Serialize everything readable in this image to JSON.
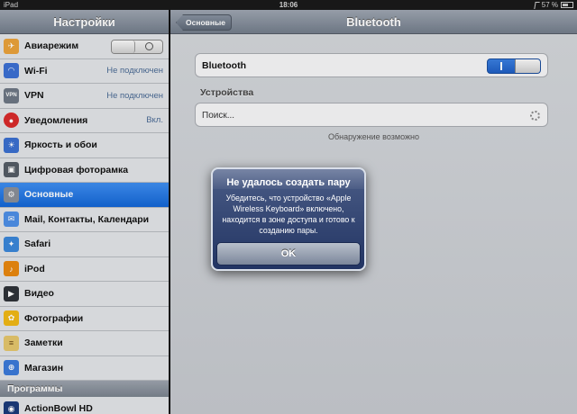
{
  "status_bar": {
    "device": "iPad",
    "time": "18:06",
    "battery": "57 %"
  },
  "sidebar": {
    "title": "Настройки",
    "items": [
      {
        "label": "Авиарежим",
        "icon": "airplane-icon",
        "color": "#e9a23b"
      },
      {
        "label": "Wi-Fi",
        "value": "Не подключен",
        "icon": "wifi-icon",
        "color": "#3b6fd2"
      },
      {
        "label": "VPN",
        "value": "Не подключен",
        "icon": "vpn-icon",
        "color": "#6d7784"
      },
      {
        "label": "Уведомления",
        "value": "Вкл.",
        "icon": "notifications-icon",
        "color": "#d92b2b"
      },
      {
        "label": "Яркость и обои",
        "icon": "brightness-icon",
        "color": "#3a6fcf"
      },
      {
        "label": "Цифровая фоторамка",
        "icon": "picture-frame-icon",
        "color": "#555c66"
      },
      {
        "label": "Основные",
        "icon": "gear-icon",
        "color": "#8a8f98"
      },
      {
        "label": "Mail, Контакты, Календари",
        "icon": "mail-icon",
        "color": "#4d8fe6"
      },
      {
        "label": "Safari",
        "icon": "safari-icon",
        "color": "#3a86d9"
      },
      {
        "label": "iPod",
        "icon": "ipod-icon",
        "color": "#e8870f"
      },
      {
        "label": "Видео",
        "icon": "video-icon",
        "color": "#2e3238"
      },
      {
        "label": "Фотографии",
        "icon": "photos-icon",
        "color": "#f0b816"
      },
      {
        "label": "Заметки",
        "icon": "notes-icon",
        "color": "#e4c66c"
      },
      {
        "label": "Магазин",
        "icon": "store-icon",
        "color": "#3b7ad9"
      }
    ],
    "section_programs": "Программы",
    "app_item": {
      "label": "ActionBowl HD",
      "icon": "actionbowl-icon",
      "color": "#1b3a7a"
    }
  },
  "detail": {
    "back_label": "Основные",
    "title": "Bluetooth",
    "bluetooth_label": "Bluetooth",
    "switch_on_mark": "I",
    "devices_header": "Устройства",
    "search_text": "Поиск...",
    "discover_text": "Обнаружение возможно"
  },
  "alert": {
    "title": "Не удалось создать пару",
    "message": "Убедитесь, что устройство «Apple Wireless Keyboard» включено, находится в зоне доступа и готово к созданию пары.",
    "ok_label": "OK"
  },
  "colors": {
    "selection": "#1a6fdc",
    "toggle_on": "#2a6dd3",
    "alert_bg": "#2c3d6b"
  }
}
